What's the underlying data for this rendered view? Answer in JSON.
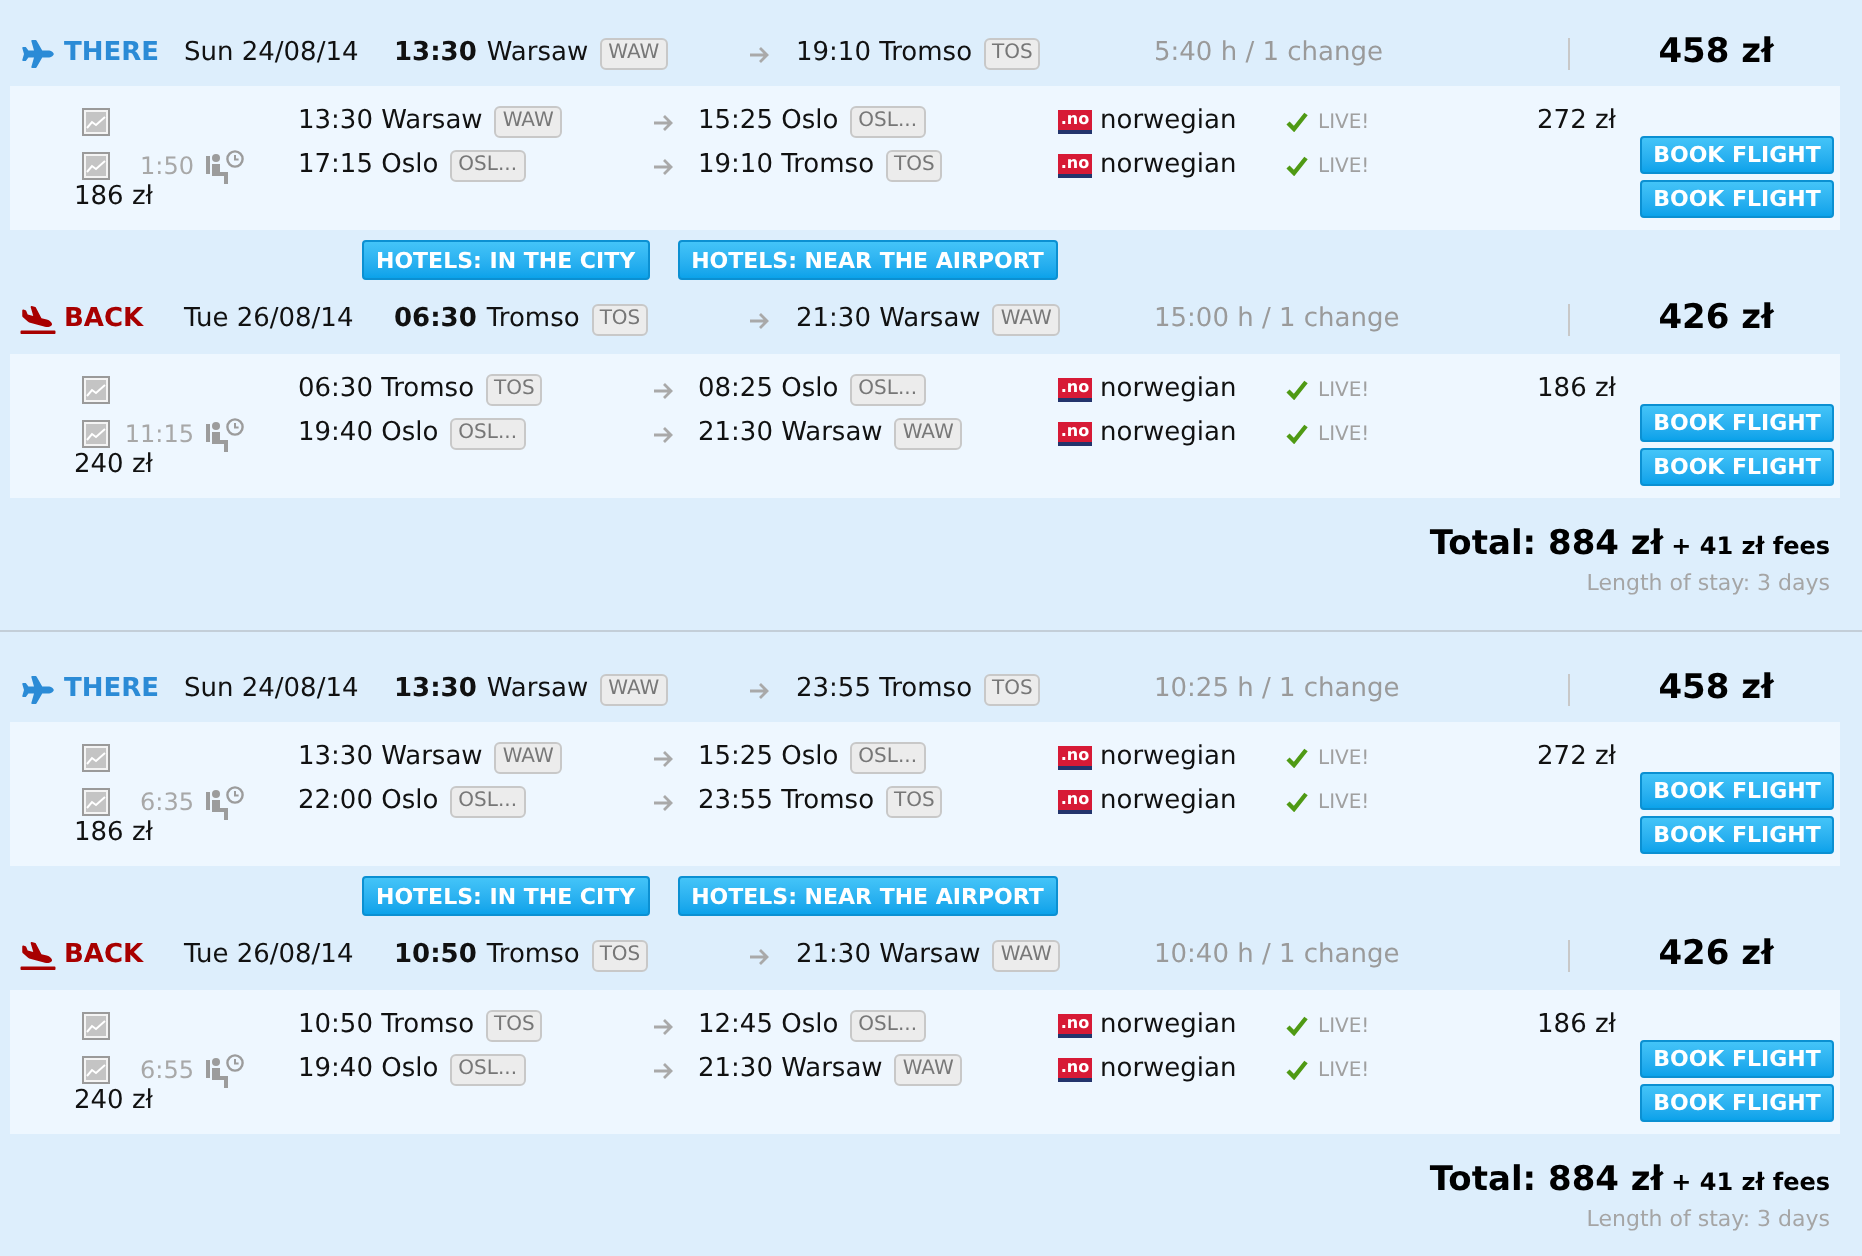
{
  "results": [
    {
      "legs": [
        {
          "kind": "there",
          "label": "THERE",
          "date": "Sun 24/08/14",
          "dep_time": "13:30",
          "dep_city": "Warsaw",
          "dep_code": "WAW",
          "arrival": "19:10 Tromso",
          "arr_code": "TOS",
          "duration": "5:40 h / 1 change",
          "price": "458 zł",
          "layover": "1:50",
          "segments": [
            {
              "departure": "13:30 Warsaw",
              "dep_code": "WAW",
              "arrival": "15:25 Oslo",
              "arr_code": "OSL...",
              "logo": ".no",
              "airline": "norwegian",
              "status": "LIVE!",
              "price": "272 zł",
              "button": "BOOK FLIGHT"
            },
            {
              "departure": "17:15 Oslo",
              "dep_code": "OSL...",
              "arrival": "19:10 Tromso",
              "arr_code": "TOS",
              "logo": ".no",
              "airline": "norwegian",
              "status": "LIVE!",
              "price": "186 zł",
              "button": "BOOK FLIGHT"
            }
          ],
          "hotels": [
            "HOTELS: IN THE CITY",
            "HOTELS: NEAR THE AIRPORT"
          ]
        },
        {
          "kind": "back",
          "label": "BACK",
          "date": "Tue 26/08/14",
          "dep_time": "06:30",
          "dep_city": "Tromso",
          "dep_code": "TOS",
          "arrival": "21:30 Warsaw",
          "arr_code": "WAW",
          "duration": "15:00 h / 1 change",
          "price": "426 zł",
          "layover": "11:15",
          "segments": [
            {
              "departure": "06:30 Tromso",
              "dep_code": "TOS",
              "arrival": "08:25 Oslo",
              "arr_code": "OSL...",
              "logo": ".no",
              "airline": "norwegian",
              "status": "LIVE!",
              "price": "186 zł",
              "button": "BOOK FLIGHT"
            },
            {
              "departure": "19:40 Oslo",
              "dep_code": "OSL...",
              "arrival": "21:30 Warsaw",
              "arr_code": "WAW",
              "logo": ".no",
              "airline": "norwegian",
              "status": "LIVE!",
              "price": "240 zł",
              "button": "BOOK FLIGHT"
            }
          ]
        }
      ],
      "total": "Total: 884 zł",
      "fees": "+ 41 zł fees",
      "stay": "Length of stay: 3 days"
    },
    {
      "legs": [
        {
          "kind": "there",
          "label": "THERE",
          "date": "Sun 24/08/14",
          "dep_time": "13:30",
          "dep_city": "Warsaw",
          "dep_code": "WAW",
          "arrival": "23:55 Tromso",
          "arr_code": "TOS",
          "duration": "10:25 h / 1 change",
          "price": "458 zł",
          "layover": "6:35",
          "segments": [
            {
              "departure": "13:30 Warsaw",
              "dep_code": "WAW",
              "arrival": "15:25 Oslo",
              "arr_code": "OSL...",
              "logo": ".no",
              "airline": "norwegian",
              "status": "LIVE!",
              "price": "272 zł",
              "button": "BOOK FLIGHT"
            },
            {
              "departure": "22:00 Oslo",
              "dep_code": "OSL...",
              "arrival": "23:55 Tromso",
              "arr_code": "TOS",
              "logo": ".no",
              "airline": "norwegian",
              "status": "LIVE!",
              "price": "186 zł",
              "button": "BOOK FLIGHT"
            }
          ],
          "hotels": [
            "HOTELS: IN THE CITY",
            "HOTELS: NEAR THE AIRPORT"
          ]
        },
        {
          "kind": "back",
          "label": "BACK",
          "date": "Tue 26/08/14",
          "dep_time": "10:50",
          "dep_city": "Tromso",
          "dep_code": "TOS",
          "arrival": "21:30 Warsaw",
          "arr_code": "WAW",
          "duration": "10:40 h / 1 change",
          "price": "426 zł",
          "layover": "6:55",
          "segments": [
            {
              "departure": "10:50 Tromso",
              "dep_code": "TOS",
              "arrival": "12:45 Oslo",
              "arr_code": "OSL...",
              "logo": ".no",
              "airline": "norwegian",
              "status": "LIVE!",
              "price": "186 zł",
              "button": "BOOK FLIGHT"
            },
            {
              "departure": "19:40 Oslo",
              "dep_code": "OSL...",
              "arrival": "21:30 Warsaw",
              "arr_code": "WAW",
              "logo": ".no",
              "airline": "norwegian",
              "status": "LIVE!",
              "price": "240 zł",
              "button": "BOOK FLIGHT"
            }
          ]
        }
      ],
      "total": "Total: 884 zł",
      "fees": "+ 41 zł fees",
      "stay": "Length of stay: 3 days"
    }
  ]
}
